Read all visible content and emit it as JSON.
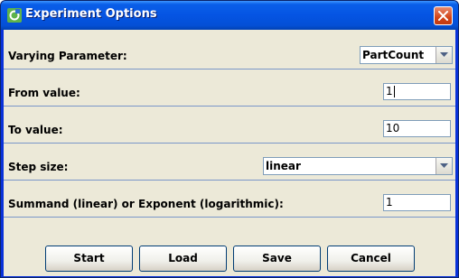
{
  "window": {
    "title": "Experiment Options",
    "icons": {
      "app": "java-app-icon",
      "close": "close-icon"
    }
  },
  "form": {
    "varying_parameter": {
      "label": "Varying Parameter:",
      "value": "PartCount"
    },
    "from_value": {
      "label": "From value:",
      "value": "1"
    },
    "to_value": {
      "label": "To value:",
      "value": "10"
    },
    "step_size": {
      "label": "Step size:",
      "value": "linear"
    },
    "summand": {
      "label": "Summand (linear) or Exponent (logarithmic):",
      "value": "1"
    }
  },
  "buttons": {
    "start": "Start",
    "load": "Load",
    "save": "Save",
    "cancel": "Cancel"
  },
  "colors": {
    "titlebar": "#0554e3",
    "client": "#ece9d8",
    "separator": "#7a96c8",
    "close": "#d24418"
  }
}
